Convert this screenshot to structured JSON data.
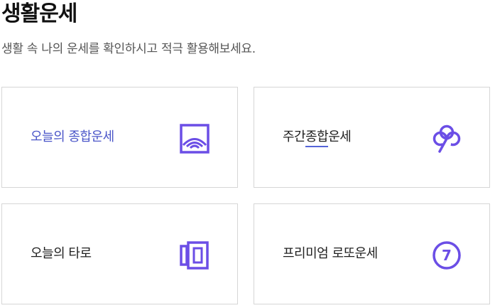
{
  "header": {
    "title": "생활운세",
    "subtitle": "생활 속 나의 운세를 확인하시고 적극 활용해보세요."
  },
  "cards": [
    {
      "label": "오늘의 종합운세",
      "icon": "sunrise-icon",
      "state": "active"
    },
    {
      "label_pre": "주간",
      "label_underline": "종합",
      "label_post": "운세",
      "icon": "clover-icon"
    },
    {
      "label": "오늘의 타로",
      "icon": "tarot-cards-icon"
    },
    {
      "label": "프리미엄 로또운세",
      "icon": "lotto-number-icon",
      "icon_text": "7"
    }
  ],
  "colors": {
    "accent": "#6b4ee6",
    "active_text": "#4a55c8",
    "border": "#d6d6d6"
  }
}
